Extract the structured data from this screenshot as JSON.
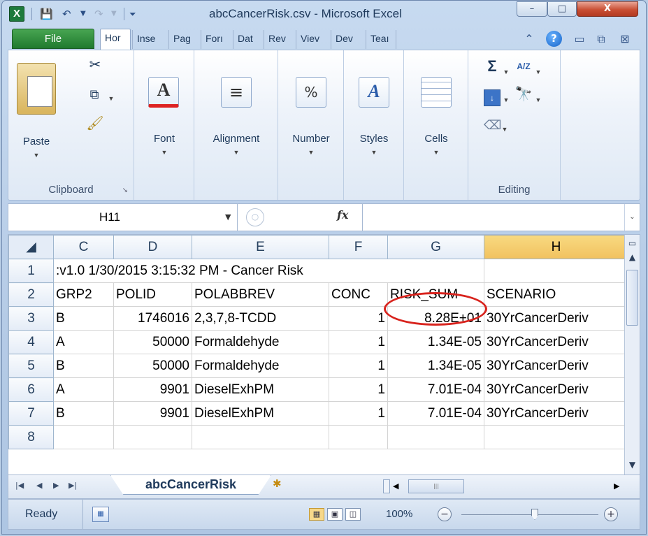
{
  "window": {
    "title": "abcCancerRisk.csv - Microsoft Excel",
    "app_icon": "X",
    "minimize": "–",
    "maximize": "□",
    "close": "X"
  },
  "ribbon_tabs": {
    "file": "File",
    "tabs": [
      "Hor",
      "Inse",
      "Pag",
      "Forı",
      "Dat",
      "Rev",
      "Viev",
      "Dev",
      "Teaı"
    ],
    "help": "?"
  },
  "ribbon": {
    "clipboard": {
      "paste": "Paste",
      "label": "Clipboard"
    },
    "font": {
      "icon": "A",
      "label": "Font"
    },
    "alignment": {
      "icon": "≡",
      "label": "Alignment"
    },
    "number": {
      "icon": "%",
      "label": "Number"
    },
    "styles": {
      "icon": "A",
      "label": "Styles"
    },
    "cells": {
      "label": "Cells"
    },
    "editing": {
      "sum": "Σ",
      "sort": "A/Z",
      "label": "Editing"
    }
  },
  "formula_bar": {
    "name_box": "H11",
    "fx": "fx",
    "formula": ""
  },
  "sheet": {
    "columns": [
      "C",
      "D",
      "E",
      "F",
      "G",
      "H"
    ],
    "rows": [
      {
        "num": "1",
        "cells": [
          ":v1.0 1/30/2015 3:15:32 PM - Cancer Risk",
          "",
          ""
        ]
      },
      {
        "num": "2",
        "cells": [
          "GRP2",
          "POLID",
          "POLABBREV",
          "CONC",
          "RISK_SUM",
          "SCENARIO"
        ]
      },
      {
        "num": "3",
        "cells": [
          "B",
          "1746016",
          "2,3,7,8-TCDD",
          "1",
          "8.28E+01",
          "30YrCancerDeriv"
        ]
      },
      {
        "num": "4",
        "cells": [
          "A",
          "50000",
          "Formaldehyde",
          "1",
          "1.34E-05",
          "30YrCancerDeriv"
        ]
      },
      {
        "num": "5",
        "cells": [
          "B",
          "50000",
          "Formaldehyde",
          "1",
          "1.34E-05",
          "30YrCancerDeriv"
        ]
      },
      {
        "num": "6",
        "cells": [
          "A",
          "9901",
          "DieselExhPM",
          "1",
          "7.01E-04",
          "30YrCancerDeriv"
        ]
      },
      {
        "num": "7",
        "cells": [
          "B",
          "9901",
          "DieselExhPM",
          "1",
          "7.01E-04",
          "30YrCancerDeriv"
        ]
      },
      {
        "num": "8",
        "cells": [
          "",
          "",
          "",
          "",
          "",
          ""
        ]
      }
    ]
  },
  "sheet_tabs": {
    "active": "abcCancerRisk"
  },
  "status": {
    "ready": "Ready",
    "zoom": "100%"
  }
}
